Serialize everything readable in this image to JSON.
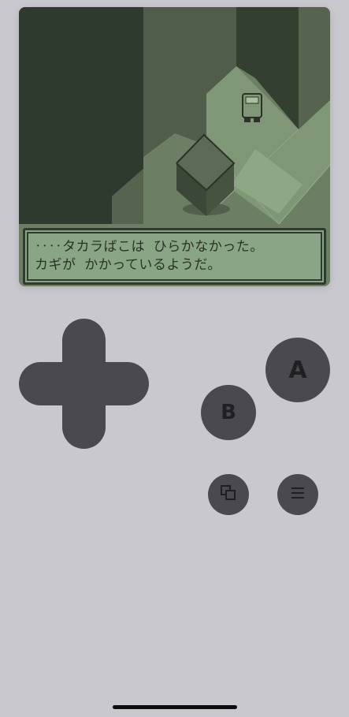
{
  "game_screen": {
    "dialog_lines": [
      "‥‥タカラばこは ひらかなかった。",
      "カギが かかっているようだ。"
    ]
  },
  "controls": {
    "a_label": "A",
    "b_label": "B",
    "screenshot_icon": "screenshot-icon",
    "menu_icon": "menu-icon"
  },
  "colors": {
    "shell": "#c9c8cf",
    "button": "#4a494f",
    "screen_dark": "#2f3a2e",
    "screen_mid": "#55634f",
    "screen_light": "#8aa585"
  }
}
